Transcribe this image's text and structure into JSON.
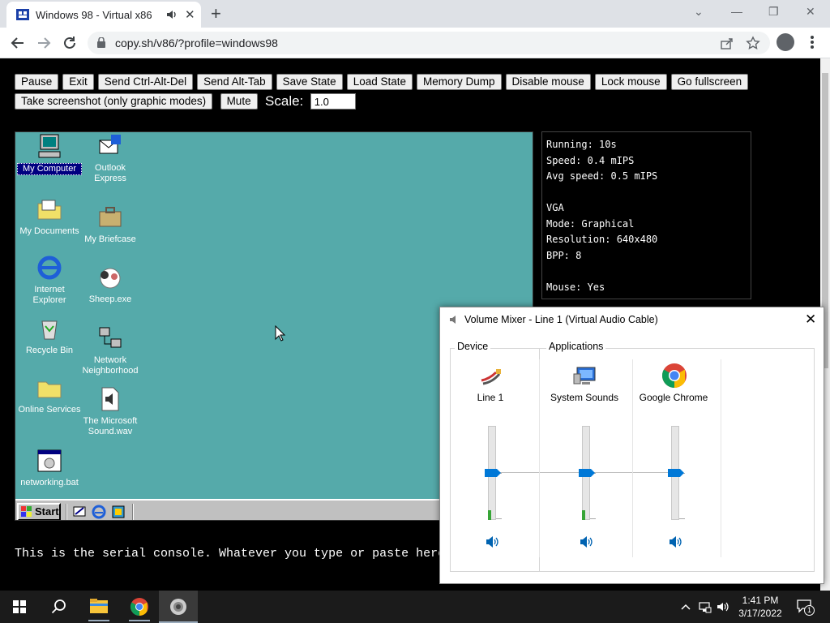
{
  "browser": {
    "tab_title": "Windows 98 - Virtual x86",
    "url": "copy.sh/v86/?profile=windows98"
  },
  "controls": {
    "buttons_row1": [
      "Pause",
      "Exit",
      "Send Ctrl-Alt-Del",
      "Send Alt-Tab",
      "Save State",
      "Load State",
      "Memory Dump",
      "Disable mouse",
      "Lock mouse",
      "Go fullscreen"
    ],
    "screenshot_label": "Take screenshot (only graphic modes)",
    "mute_label": "Mute",
    "scale_label": "Scale:",
    "scale_value": "1.0"
  },
  "desktop": {
    "icons": [
      {
        "label": "My Computer",
        "icon": "my-computer-icon"
      },
      {
        "label": "Outlook Express",
        "icon": "outlook-express-icon"
      },
      {
        "label": "My Documents",
        "icon": "my-documents-icon"
      },
      {
        "label": "My Briefcase",
        "icon": "my-briefcase-icon"
      },
      {
        "label": "Internet Explorer",
        "icon": "internet-explorer-icon"
      },
      {
        "label": "Sheep.exe",
        "icon": "sheep-icon"
      },
      {
        "label": "Recycle Bin",
        "icon": "recycle-bin-icon"
      },
      {
        "label": "Network Neighborhood",
        "icon": "network-icon"
      },
      {
        "label": "Online Services",
        "icon": "folder-icon"
      },
      {
        "label": "The Microsoft Sound.wav",
        "icon": "sound-file-icon"
      },
      {
        "label": "networking.bat",
        "icon": "batch-file-icon"
      }
    ],
    "start_label": "Start"
  },
  "stats": {
    "running": "Running: 10s",
    "speed": "Speed: 0.4 mIPS",
    "avg_speed": "Avg speed: 0.5 mIPS",
    "vga_header": "VGA",
    "mode": "Mode: Graphical",
    "resolution": "Resolution: 640x480",
    "bpp": "BPP: 8",
    "mouse": "Mouse: Yes"
  },
  "serial_text": "This is the serial console. Whatever you type or paste here",
  "mixer": {
    "title": "Volume Mixer - Line 1 (Virtual Audio Cable)",
    "device_group": "Device",
    "apps_group": "Applications",
    "channels": [
      {
        "name": "Line 1",
        "icon": "audio-cable-icon",
        "volume": 0.5
      },
      {
        "name": "System Sounds",
        "icon": "system-sounds-icon",
        "volume": 0.5
      },
      {
        "name": "Google Chrome",
        "icon": "chrome-icon",
        "volume": 0.5
      }
    ]
  },
  "taskbar": {
    "time": "1:41 PM",
    "date": "3/17/2022",
    "notification_count": "1"
  },
  "colors": {
    "desktop_teal": "#55aaaa",
    "slider_blue": "#0078d7",
    "taskbar_dark": "#1b1b1b"
  }
}
